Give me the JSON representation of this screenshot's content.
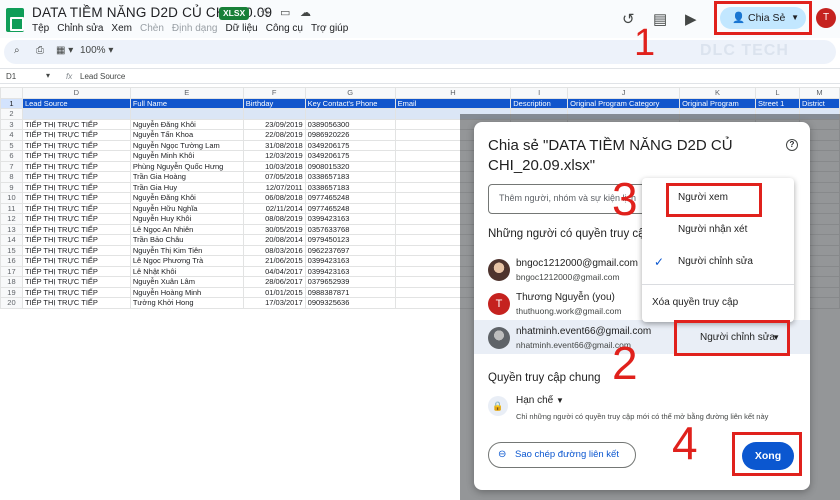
{
  "header": {
    "title": "DATA TIỀM NĂNG D2D CỦ CHI_20.09",
    "badge": "XLSX",
    "menu": [
      "Tệp",
      "Chỉnh sửa",
      "Xem",
      "Chèn",
      "Định dạng",
      "Dữ liệu",
      "Công cụ",
      "Trợ giúp"
    ],
    "share_label": "Chia Sẻ",
    "avatar_letter": "T"
  },
  "toolbar": {
    "zoom": "100%"
  },
  "formula_bar": {
    "cell_ref": "D1",
    "fx": "fx",
    "content": "Lead Source"
  },
  "watermark": "DLC TECH",
  "grid": {
    "col_letters": [
      "",
      "D",
      "E",
      "F",
      "G",
      "H",
      "I",
      "J",
      "K",
      "L",
      "M"
    ],
    "header_row_num": "1",
    "headers": [
      "Lead Source",
      "Full Name",
      "Birthday",
      "Key Contact's Phone",
      "Email",
      "Description",
      "Original Program Category",
      "Original Program",
      "Street 1",
      "District"
    ],
    "blank_row_num": "2",
    "rows": [
      {
        "n": "3",
        "src": "TIẾP THỊ TRỰC TIẾP",
        "name": "Nguyễn Đăng Khôi",
        "dob": "23/09/2019",
        "phone": "0389056300"
      },
      {
        "n": "4",
        "src": "TIẾP THỊ TRỰC TIẾP",
        "name": "Nguyễn Tấn Khoa",
        "dob": "22/08/2019",
        "phone": "0986920226"
      },
      {
        "n": "5",
        "src": "TIẾP THỊ TRỰC TIẾP",
        "name": "Nguyễn Ngọc Tường Lam",
        "dob": "31/08/2018",
        "phone": "0349206175"
      },
      {
        "n": "6",
        "src": "TIẾP THỊ TRỰC TIẾP",
        "name": "Nguyễn Minh Khôi",
        "dob": "12/03/2019",
        "phone": "0349206175"
      },
      {
        "n": "7",
        "src": "TIẾP THỊ TRỰC TIẾP",
        "name": "Phùng Nguyễn Quốc Hưng",
        "dob": "10/03/2018",
        "phone": "0908015320"
      },
      {
        "n": "8",
        "src": "TIẾP THỊ TRỰC TIẾP",
        "name": "Trần Gia Hoàng",
        "dob": "07/05/2018",
        "phone": "0338657183"
      },
      {
        "n": "9",
        "src": "TIẾP THỊ TRỰC TIẾP",
        "name": "Trần Gia Huy",
        "dob": "12/07/2011",
        "phone": "0338657183"
      },
      {
        "n": "10",
        "src": "TIẾP THỊ TRỰC TIẾP",
        "name": "Nguyễn Đăng Khôi",
        "dob": "06/08/2018",
        "phone": "0977465248"
      },
      {
        "n": "11",
        "src": "TIẾP THỊ TRỰC TIẾP",
        "name": "Nguyễn Hữu Nghĩa",
        "dob": "02/11/2014",
        "phone": "0977465248"
      },
      {
        "n": "12",
        "src": "TIẾP THỊ TRỰC TIẾP",
        "name": "Nguyễn Huy Khôi",
        "dob": "08/08/2019",
        "phone": "0399423163"
      },
      {
        "n": "13",
        "src": "TIẾP THỊ TRỰC TIẾP",
        "name": "Lê Ngọc An Nhiên",
        "dob": "30/05/2019",
        "phone": "0357633768"
      },
      {
        "n": "14",
        "src": "TIẾP THỊ TRỰC TIẾP",
        "name": "Trần Bảo Châu",
        "dob": "20/08/2014",
        "phone": "0979450123"
      },
      {
        "n": "15",
        "src": "TIẾP THỊ TRỰC TIẾP",
        "name": "Nguyễn Thị Kim Tiên",
        "dob": "08/03/2016",
        "phone": "0962237697"
      },
      {
        "n": "16",
        "src": "TIẾP THỊ TRỰC TIẾP",
        "name": "Lê Ngọc Phương Trà",
        "dob": "21/06/2015",
        "phone": "0399423163"
      },
      {
        "n": "17",
        "src": "TIẾP THỊ TRỰC TIẾP",
        "name": "Lê Nhật Khôi",
        "dob": "04/04/2017",
        "phone": "0399423163"
      },
      {
        "n": "18",
        "src": "TIẾP THỊ TRỰC TIẾP",
        "name": "Nguyễn Xuân Lâm",
        "dob": "28/06/2017",
        "phone": "0379652939"
      },
      {
        "n": "19",
        "src": "TIẾP THỊ TRỰC TIẾP",
        "name": "Nguyễn Hoàng Minh",
        "dob": "01/01/2015",
        "phone": "0988387871"
      },
      {
        "n": "20",
        "src": "TIẾP THỊ TRỰC TIẾP",
        "name": "Tưởng Khởi Hong",
        "dob": "17/03/2017",
        "phone": "0909325636"
      }
    ]
  },
  "dialog": {
    "title": "Chia sẻ \"DATA TIỀM NĂNG D2D CỦ CHI_20.09.xlsx\"",
    "add_placeholder": "Thêm người, nhóm và sự kiện lịch",
    "people_heading": "Những người có quyền truy cập",
    "people": [
      {
        "name": "bngoc1212000@gmail.com",
        "email": "bngoc1212000@gmail.com",
        "color": "#8d6e63",
        "initial": ""
      },
      {
        "name": "Thương Nguyễn (you)",
        "email": "thuthuong.work@gmail.com",
        "color": "#c5221f",
        "initial": "T"
      },
      {
        "name": "nhatminh.event66@gmail.com",
        "email": "nhatminh.event66@gmail.com",
        "color": "#5f6368",
        "initial": ""
      }
    ],
    "role_label": "Người chỉnh sửa",
    "general_heading": "Quyền truy cập chung",
    "restrict_label": "Hạn chế",
    "restrict_desc": "Chỉ những người có quyền truy cập mới có thể mở bằng đường liên kết này",
    "copy_link": "Sao chép đường liên kết",
    "done": "Xong"
  },
  "role_menu": {
    "items": [
      "Người xem",
      "Người nhận xét",
      "Người chỉnh sửa"
    ],
    "remove": "Xóa quyền truy cập"
  },
  "annotations": [
    "1",
    "2",
    "3",
    "4"
  ],
  "colors": {
    "accent": "#0b57d0",
    "highlight": "#e0211c",
    "header_blue": "#1155cc"
  }
}
